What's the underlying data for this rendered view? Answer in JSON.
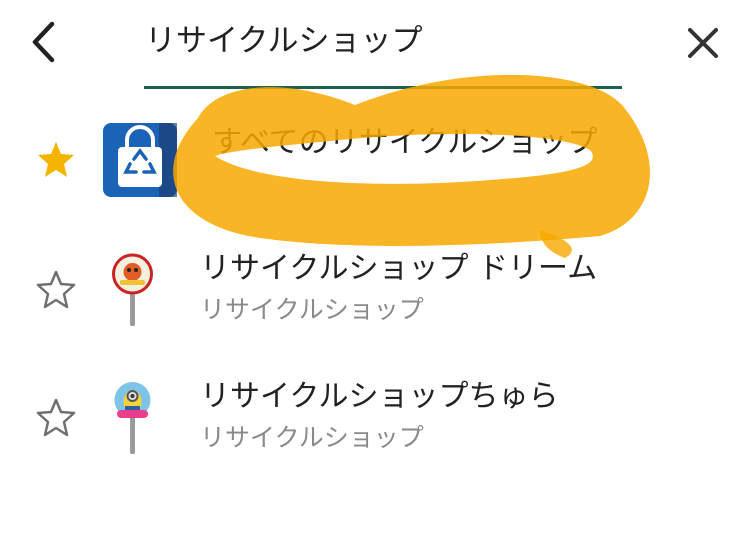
{
  "search": {
    "query": "リサイクルショップ"
  },
  "colors": {
    "accent_star": "#f5b400",
    "outline_star": "#6f6f6f",
    "underline": "#1f5f4e",
    "highlight": "#f8a800"
  },
  "icons": {
    "back": "chevron-left-icon",
    "close": "close-icon",
    "favorite": "star-filled-icon",
    "not_favorite": "star-outline-icon"
  },
  "results": [
    {
      "title": "すべてのリサイクルショップ",
      "subtitle": "",
      "favorite": true,
      "icon": "recycle-bag-icon"
    },
    {
      "title": "リサイクルショップ ドリーム",
      "subtitle": "リサイクルショップ",
      "favorite": false,
      "icon": "map-pin-sign-icon"
    },
    {
      "title": "リサイクルショップちゅら",
      "subtitle": "リサイクルショップ",
      "favorite": false,
      "icon": "map-pin-character-icon"
    }
  ]
}
